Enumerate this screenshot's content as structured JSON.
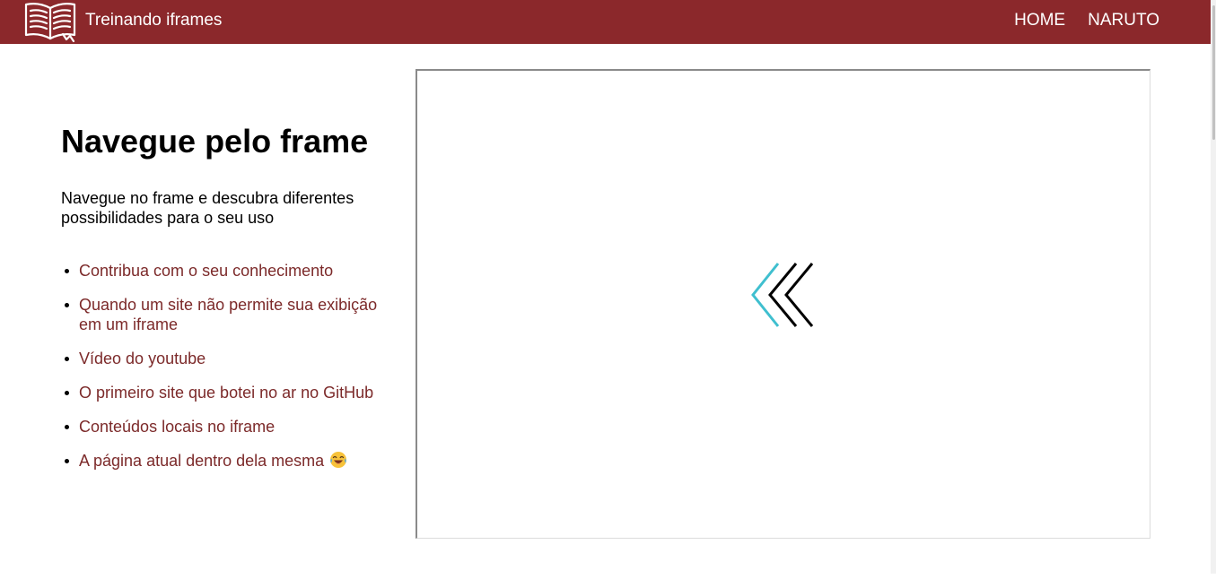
{
  "header": {
    "logo_icon": "open-book-icon",
    "site_title": "Treinando iframes",
    "nav": [
      {
        "label": "HOME"
      },
      {
        "label": "NARUTO"
      }
    ],
    "background_color": "#8b282b"
  },
  "main": {
    "title": "Navegue pelo frame",
    "intro": "Navegue no frame e descubra diferentes possibilidades para o seu uso",
    "links": [
      {
        "label": "Contribua com o seu conhecimento"
      },
      {
        "label": "Quando um site não permite sua exibição em um iframe"
      },
      {
        "label": "Vídeo do youtube"
      },
      {
        "label": "O primeiro site que botei no ar no GitHub"
      },
      {
        "label": "Conteúdos locais no iframe"
      },
      {
        "label": "A página atual dentro dela mesma",
        "emoji_icon": "laughing-tears-emoji-icon"
      }
    ],
    "link_color": "#7c2a2a"
  },
  "iframe": {
    "content_icon": "triple-chevron-left-icon",
    "accent_color": "#3fbfcf"
  }
}
